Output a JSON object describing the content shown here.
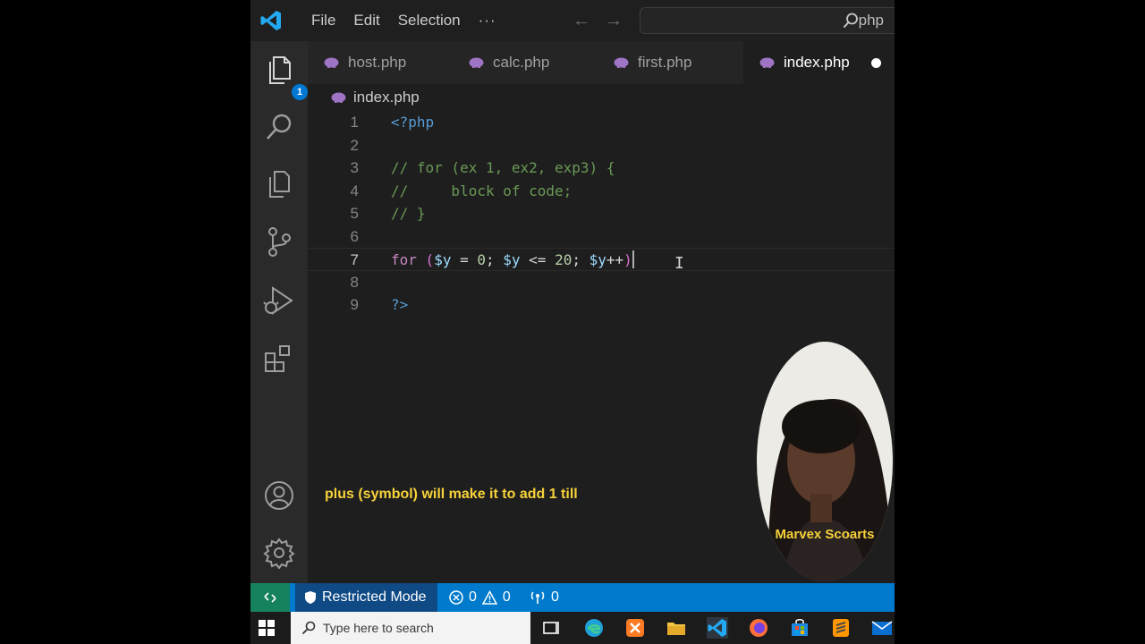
{
  "menu": [
    "File",
    "Edit",
    "Selection",
    "···"
  ],
  "command_center": "php",
  "activity": {
    "explorer_badge": "1"
  },
  "tabs": [
    {
      "label": "host.php"
    },
    {
      "label": "calc.php"
    },
    {
      "label": "first.php"
    },
    {
      "label": "index.php"
    }
  ],
  "breadcrumb": "index.php",
  "editor": {
    "line_numbers": [
      "1",
      "2",
      "3",
      "4",
      "5",
      "6",
      "7",
      "8",
      "9"
    ],
    "lines": {
      "l1": "<?php",
      "l3": "// for (ex 1, ex2, exp3) {",
      "l4": "//     block of code;",
      "l5": "// }",
      "l7": {
        "kw": "for",
        "open": "(",
        "var1": "$y",
        "eq": " = ",
        "zero": "0",
        "semi1": "; ",
        "var2": "$y",
        "le": " <= ",
        "twenty": "20",
        "semi2": "; ",
        "var3": "$y",
        "inc": "++",
        "close": ")"
      },
      "l9": "?>"
    },
    "cursor_icon": "I"
  },
  "caption": "plus (symbol) will make it to add 1 till",
  "presenter_name": "Marvex Scoarts",
  "status": {
    "restricted_mode": "Restricted Mode",
    "errors": "0",
    "warnings": "0",
    "ports": "0"
  },
  "taskbar": {
    "search_placeholder": "Type here to search"
  },
  "colors": {
    "status_blue": "#007acc",
    "caption_yellow": "#f6d13a",
    "accent": "#0078d4"
  }
}
